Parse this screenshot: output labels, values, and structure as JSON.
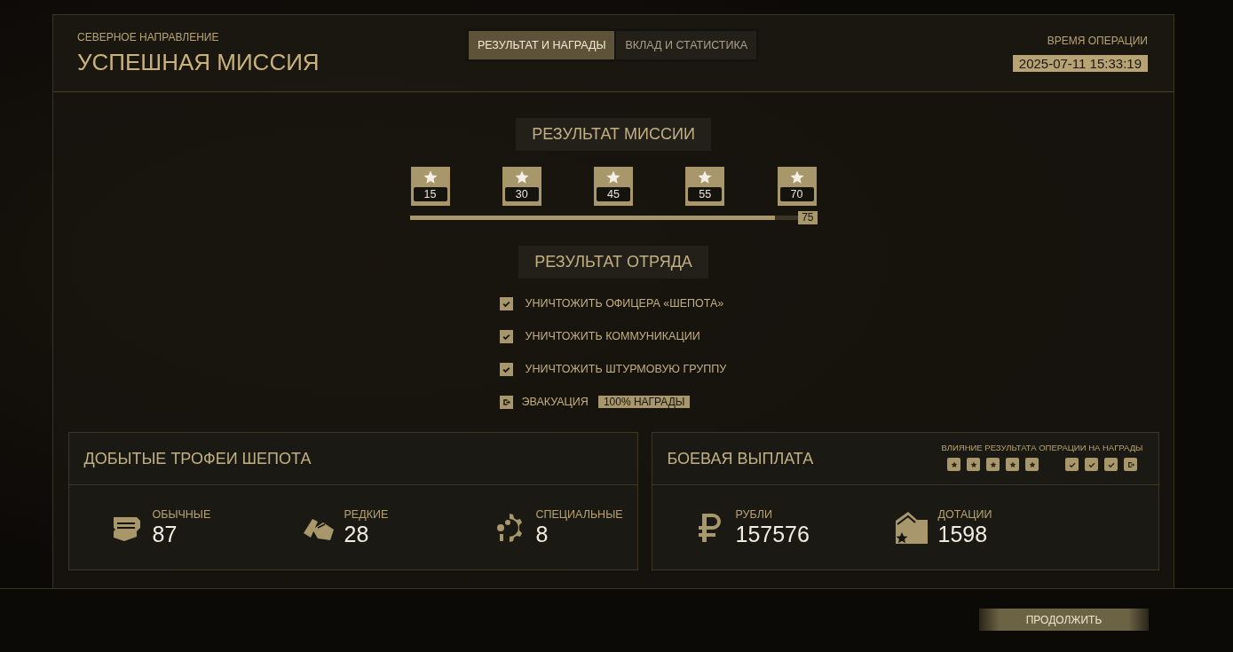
{
  "header": {
    "subtitle": "СЕВЕРНОЕ НАПРАВЛЕНИЕ",
    "title": "УСПЕШНАЯ МИССИЯ",
    "time_label": "ВРЕМЯ ОПЕРАЦИИ",
    "time": "2025-07-11 15:33:19"
  },
  "tabs": [
    {
      "label": "РЕЗУЛЬТАТ И НАГРАДЫ",
      "selected": true
    },
    {
      "label": "ВКЛАД И СТАТИСТИКА",
      "selected": false
    }
  ],
  "mission": {
    "heading": "РЕЗУЛЬТАТ МИССИИ",
    "milestones": [
      {
        "value": "15",
        "reached": true
      },
      {
        "value": "30",
        "reached": true
      },
      {
        "value": "45",
        "reached": true
      },
      {
        "value": "55",
        "reached": true
      },
      {
        "value": "70",
        "reached": true
      }
    ],
    "progress": {
      "level": 0.94,
      "reading": "75"
    }
  },
  "squad": {
    "heading": "РЕЗУЛЬТАТ ОТРЯДА",
    "objectives": [
      {
        "kind": "task",
        "label": "УНИЧТОЖИТЬ ОФИЦЕРА «ШЕПОТА»",
        "checked": true
      },
      {
        "kind": "task",
        "label": "УНИЧТОЖИТЬ КОММУНИКАЦИИ",
        "checked": true
      },
      {
        "kind": "task",
        "label": "УНИЧТОЖИТЬ ШТУРМОВУЮ ГРУППУ",
        "checked": true
      },
      {
        "kind": "evac",
        "label": "ЭВАКУАЦИЯ",
        "badge": "100% НАГРАДЫ",
        "checked": true
      }
    ]
  },
  "trophies": {
    "title": "ДОБЫТЫЕ ТРОФЕИ ШЕПОТА",
    "items": [
      {
        "kind": "common",
        "label": "ОБЫЧНЫЕ",
        "value": "87"
      },
      {
        "kind": "rare",
        "label": "РЕДКИЕ",
        "value": "28"
      },
      {
        "kind": "special",
        "label": "СПЕЦИАЛЬНЫЕ",
        "value": "8"
      }
    ]
  },
  "payout": {
    "title": "БОЕВАЯ ВЫПЛАТА",
    "influence_label": "ВЛИЯНИЕ РЕЗУЛЬТАТА ОПЕРАЦИИ НА НАГРАДЫ",
    "influence": [
      {
        "kind": "star",
        "on": true
      },
      {
        "kind": "star",
        "on": true
      },
      {
        "kind": "star",
        "on": true
      },
      {
        "kind": "star",
        "on": true
      },
      {
        "kind": "star",
        "on": true
      },
      {
        "kind": "check",
        "on": true
      },
      {
        "kind": "check",
        "on": true
      },
      {
        "kind": "check",
        "on": true
      },
      {
        "kind": "evac",
        "on": true
      }
    ],
    "items": [
      {
        "kind": "rubles",
        "label": "РУБЛИ",
        "value": "157576"
      },
      {
        "kind": "subsidy",
        "label": "ДОТАЦИИ",
        "value": "1598"
      }
    ]
  },
  "continue_button": "ПРОДОЛЖИТЬ"
}
